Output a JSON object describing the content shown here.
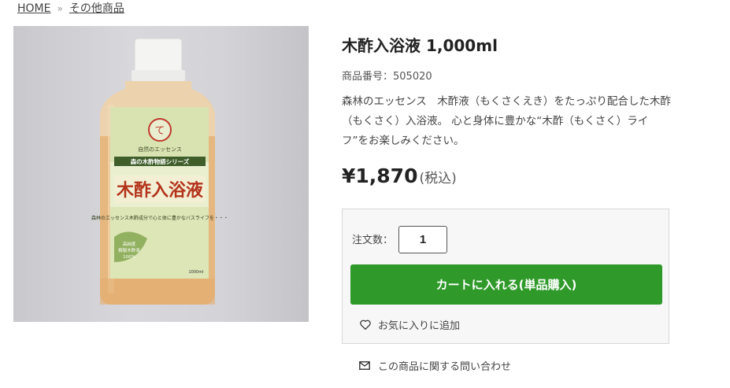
{
  "breadcrumb": {
    "home": "HOME",
    "separator": "»",
    "category": "その他商品"
  },
  "product": {
    "title": "木酢入浴液 1,000ml",
    "code": "商品番号：505020",
    "description": "森林のエッセンス　木酢液（もくさくえき）をたっぷり配合した木酢（もくさく）入浴液。 心と身体に豊かな“木酢（もくさく）ライフ”をお楽しみください。",
    "price": "¥1,870",
    "tax_note": "(税込)",
    "image": {
      "header": "自然のエッセンス",
      "series": "森の木酢物語シリーズ",
      "name": "木酢入浴液",
      "tagline": "森林のエッセンス木酢成分で心と体に豊かなバスライフを・・・",
      "badge_1": "高純度",
      "badge_2": "精製木酢液",
      "badge_3": "100%",
      "volume": "1000ml"
    }
  },
  "cart": {
    "qty_label": "注文数：",
    "qty_value": "1",
    "add_button": "カートに入れる(単品購入)",
    "favorite": "お気に入りに追加"
  },
  "inquiry": "この商品に関する問い合わせ",
  "colors": {
    "accent_green": "#2f9a2a",
    "border": "#d8d8d8"
  },
  "icons": {
    "favorite": "heart-icon",
    "inquiry": "mail-icon"
  }
}
